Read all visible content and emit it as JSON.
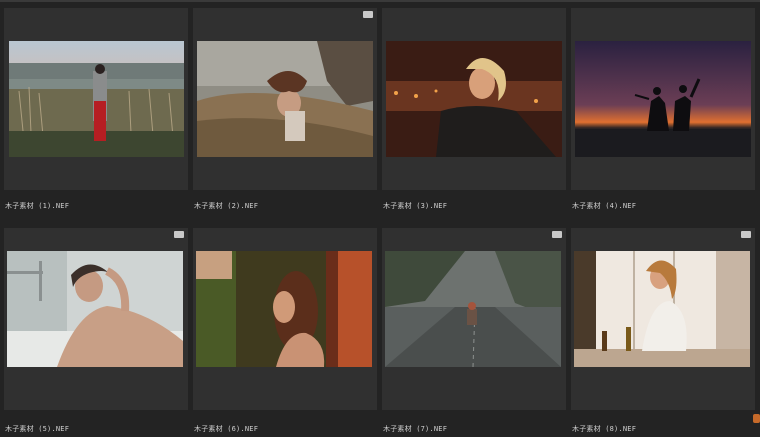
{
  "thumbnails": [
    {
      "caption": "木子素材 (1).NEF",
      "has_badge": false
    },
    {
      "caption": "木子素材 (2).NEF",
      "has_badge": true
    },
    {
      "caption": "木子素材 (3).NEF",
      "has_badge": false
    },
    {
      "caption": "木子素材 (4).NEF",
      "has_badge": false
    },
    {
      "caption": "木子素材 (5).NEF",
      "has_badge": true
    },
    {
      "caption": "木子素材 (6).NEF",
      "has_badge": false
    },
    {
      "caption": "木子素材 (7).NEF",
      "has_badge": true
    },
    {
      "caption": "木子素材 (8).NEF",
      "has_badge": true
    }
  ],
  "colors": {
    "background": "#232323",
    "card": "#303030",
    "caption": "#cfcfcf"
  }
}
